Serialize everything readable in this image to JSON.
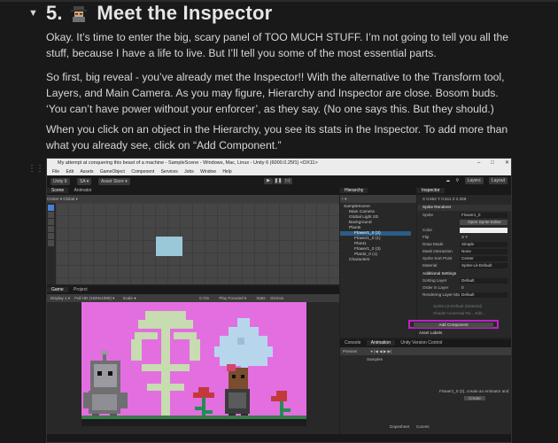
{
  "heading": {
    "number": "5.",
    "title": "Meet the Inspector"
  },
  "paragraphs": [
    "Okay. It’s time to enter the big, scary panel of TOO MUCH STUFF. I’m not going to tell you all the stuff, because I have a life to live. But I’ll tell you some of the most essential parts.",
    "So first, big reveal - you’ve already met the Inspector!! With the alternative to the Transform tool, Layers, and Main Camera. As you may figure, Hierarchy and Inspector are close. Bosom buds. ‘You can’t have power without your enforcer’, as they say. (No one says this. But they should.)",
    "When you click on an object in the Hierarchy, you see its stats in the Inspector. To add more than what you already see, click on “Add Component.”"
  ],
  "unity": {
    "window_title": "My attempt at conquering this beast of a machine - SampleScene - Windows, Mac, Linux - Unity 6 (6000.0.25f1) <DX11>",
    "menu": [
      "File",
      "Edit",
      "Assets",
      "GameObject",
      "Component",
      "Services",
      "Jobs",
      "Window",
      "Help"
    ],
    "toolbar": {
      "account": "Unity 6",
      "user": "SA ▾",
      "asset_store": "Asset Store ▾",
      "layers": "Layers",
      "layout": "Layout"
    },
    "scene_tabs": [
      "Scene",
      "Animator"
    ],
    "scene_toolbar": "Center ▾   Global ▾",
    "game_tabs": [
      "Game",
      "Project"
    ],
    "game_toolbar": {
      "display": "Display 1 ▾",
      "resolution": "Full HD (1920x1080) ▾",
      "scale": "Scale ●",
      "zoom": "0.72x",
      "play_focused": "Play Focused ▾",
      "stats": "Stats",
      "gizmos": "Gizmos"
    },
    "hierarchy": {
      "tab": "Hierarchy",
      "rows": [
        "SampleScene",
        "Main Camera",
        "Global Light 2D",
        "Background",
        "Plants",
        "Flower1_0 (2)",
        "Flower1_0 (1)",
        "Plant1",
        "Flower1_0 (3)",
        "Plant2_0 (1)",
        "Characters"
      ],
      "selected_index": 5
    },
    "inspector": {
      "tab": "Inspector",
      "position": "X 0.652  Y 0.511  Z 2.259",
      "component": "Sprite Renderer",
      "fields": [
        {
          "label": "Sprite",
          "value": "Flower1_0"
        },
        {
          "label": "",
          "value": "Open Sprite Editor"
        },
        {
          "label": "Color",
          "value": ""
        },
        {
          "label": "Flip",
          "value": "X  Y"
        },
        {
          "label": "Draw Mode",
          "value": "Simple"
        },
        {
          "label": "Mask Interaction",
          "value": "None"
        },
        {
          "label": "Sprite Sort Point",
          "value": "Center"
        },
        {
          "label": "Material",
          "value": "Sprite-Lit-Default"
        }
      ],
      "additional": "Additional Settings",
      "fields2": [
        {
          "label": "Sorting Layer",
          "value": "Default"
        },
        {
          "label": "Order in Layer",
          "value": "0"
        },
        {
          "label": "Rendering Layer Mask",
          "value": "Default"
        }
      ],
      "material_name": "Sprite-Lit-Default (Material)",
      "shader": "Shader  Universal Re...  Edit...",
      "add_component": "Add Component",
      "asset_labels": "Asset Labels"
    },
    "bottom": {
      "tabs": [
        "Console",
        "Animation",
        "Unity Version Control"
      ],
      "preview": "Preview",
      "samples": "Samples",
      "create_msg": "Flower1_0 (2), create an Animator and",
      "create_btn": "Create",
      "dopesheet": "Dopesheet",
      "curves": "Curves"
    }
  },
  "colors": {
    "game_background": "#e36ee0",
    "highlight": "#c11fc8",
    "sky_plant": "#c7dcb0",
    "blue_plant": "#b7d6ec"
  }
}
